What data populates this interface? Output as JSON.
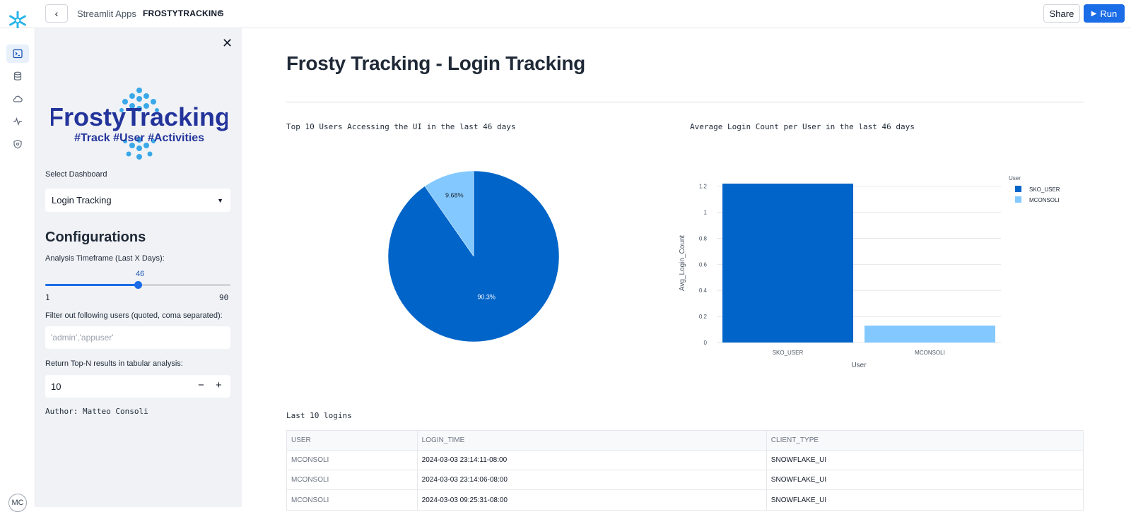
{
  "topbar": {
    "back_icon": "chevron-left-icon",
    "breadcrumb_apps": "Streamlit Apps",
    "app_name": "FROSTYTRACKING",
    "share_label": "Share",
    "run_label": "Run"
  },
  "rail": {
    "items": [
      "code-icon",
      "database-icon",
      "cloud-icon",
      "activity-icon",
      "shield-icon"
    ],
    "avatar": "MC"
  },
  "sidebar": {
    "brand_title": "FrostyTracking",
    "brand_tagline": "#Track #User #Activities",
    "select_label": "Select Dashboard",
    "select_value": "Login Tracking",
    "config_title": "Configurations",
    "slider_label": "Analysis Timeframe (Last X Days):",
    "slider_value": "46",
    "slider_min": "1",
    "slider_max": "90",
    "slider_fraction": 0.5,
    "filter_label": "Filter out following users (quoted, coma separated):",
    "filter_placeholder": "'admin','appuser'",
    "topn_label": "Return Top-N results in tabular analysis:",
    "topn_value": "10",
    "author": "Author: Matteo Consoli"
  },
  "main": {
    "title": "Frosty Tracking - Login Tracking",
    "pie_caption": "Top 10 Users Accessing the UI in the last 46 days",
    "bar_caption": "Average Login Count per User in the last 46 days",
    "table_caption": "Last 10 logins"
  },
  "chart_data": [
    {
      "type": "pie",
      "labels": [
        "",
        ""
      ],
      "values": [
        90.3,
        9.68
      ],
      "value_labels": [
        "90.3%",
        "9.68%"
      ],
      "colors": [
        "#0064c8",
        "#83c9ff"
      ]
    },
    {
      "type": "bar",
      "categories": [
        "SKO_USER",
        "MCONSOLI"
      ],
      "values": [
        1.22,
        0.13
      ],
      "xlabel": "User",
      "ylabel": "Avg_Login_Count",
      "ylim": [
        0,
        1.22
      ],
      "yticks": [
        "0",
        "0.2",
        "0.4",
        "0.6",
        "0.8",
        "1",
        "1.2"
      ],
      "legend_title": "User",
      "legend_position": "top-right",
      "series": [
        {
          "name": "SKO_USER",
          "color": "#0064c8"
        },
        {
          "name": "MCONSOLI",
          "color": "#83c9ff"
        }
      ],
      "grid": true
    }
  ],
  "table": {
    "columns": [
      "USER",
      "LOGIN_TIME",
      "CLIENT_TYPE"
    ],
    "rows": [
      [
        "MCONSOLI",
        "2024-03-03 23:14:11-08:00",
        "SNOWFLAKE_UI"
      ],
      [
        "MCONSOLI",
        "2024-03-03 23:14:06-08:00",
        "SNOWFLAKE_UI"
      ],
      [
        "MCONSOLI",
        "2024-03-03 09:25:31-08:00",
        "SNOWFLAKE_UI"
      ]
    ]
  }
}
